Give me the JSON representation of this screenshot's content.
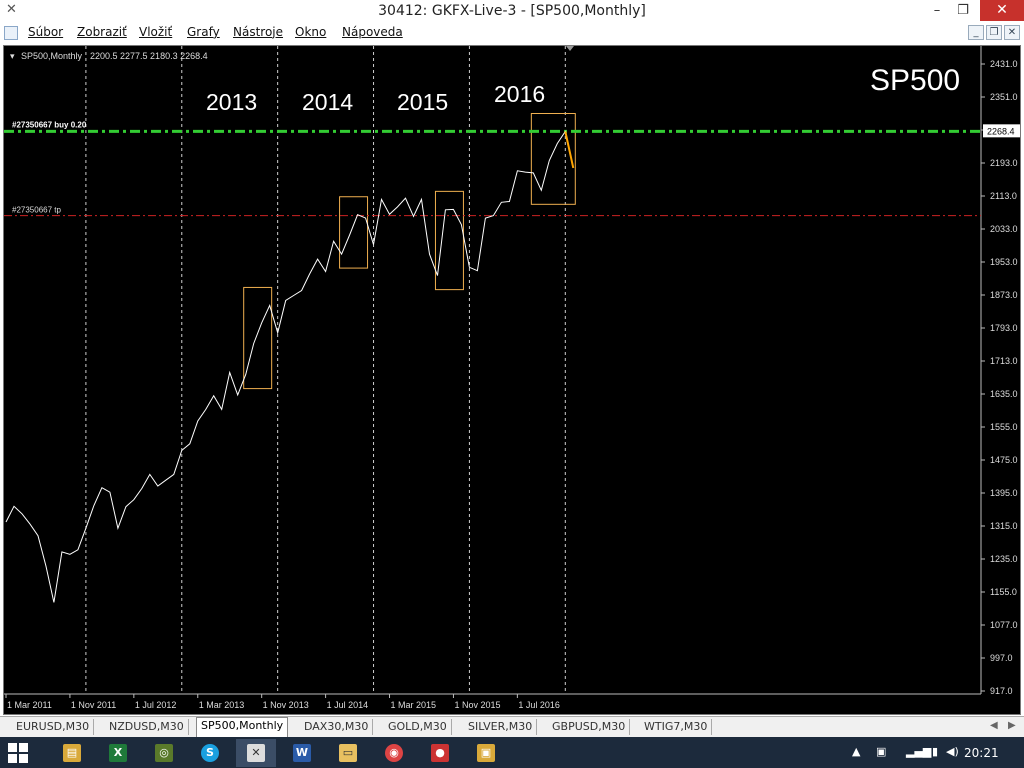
{
  "window": {
    "title": "30412: GKFX-Live-3 - [SP500,Monthly]"
  },
  "menu": [
    "Súbor",
    "Zobraziť",
    "Vložiť",
    "Grafy",
    "Nástroje",
    "Okno",
    "Nápoveda"
  ],
  "chart_header": {
    "symbol": "SP500,Monthly",
    "ohlc": "2200.5 2277.5 2180.3 2268.4"
  },
  "chart_title": "SP500",
  "chart_data": {
    "type": "line",
    "title": "SP500",
    "ylim": [
      917.0,
      2470.0
    ],
    "y_ticks": [
      "2431.0",
      "2351.0",
      "2271.0",
      "2193.0",
      "2113.0",
      "2033.0",
      "1953.0",
      "1873.0",
      "1793.0",
      "1713.0",
      "1635.0",
      "1555.0",
      "1475.0",
      "1395.0",
      "1315.0",
      "1235.0",
      "1155.0",
      "1077.0",
      "997.0",
      "917.0"
    ],
    "x_ticks": [
      "1 Mar 2011",
      "1 Nov 2011",
      "1 Jul 2012",
      "1 Mar 2013",
      "1 Nov 2013",
      "1 Jul 2014",
      "1 Mar 2015",
      "1 Nov 2015",
      "1 Jul 2016"
    ],
    "year_labels": [
      "2013",
      "2014",
      "2015",
      "2016"
    ],
    "current_price": "2268.4",
    "buy_line_label": "#27350667 buy 0.20",
    "buy_line_price": 2268.4,
    "tp_line_label": "#27350667 tp",
    "tp_line_price": 2065,
    "series": [
      {
        "values": [
          1325,
          1363,
          1345,
          1320,
          1292,
          1218,
          1131,
          1253,
          1247,
          1258,
          1310,
          1365,
          1408,
          1397,
          1310,
          1362,
          1379,
          1406,
          1440,
          1412,
          1426,
          1440,
          1498,
          1514,
          1569,
          1597,
          1630,
          1597,
          1686,
          1632,
          1681,
          1756,
          1806,
          1848,
          1782,
          1860,
          1872,
          1884,
          1924,
          1960,
          1930,
          2003,
          1972,
          2018,
          2067,
          2059,
          1995,
          2104,
          2068,
          2086,
          2107,
          2063,
          2104,
          1972,
          1920,
          2079,
          2080,
          2043,
          1940,
          1932,
          2059,
          2065,
          2097,
          2099,
          2173,
          2170,
          2168,
          2126,
          2198,
          2239,
          2268,
          2180
        ]
      }
    ]
  },
  "tabs": [
    "EURUSD,M30",
    "NZDUSD,M30",
    "SP500,Monthly",
    "DAX30,M30",
    "GOLD,M30",
    "SILVER,M30",
    "GBPUSD,M30",
    "WTIG7,M30"
  ],
  "active_tab": "SP500,Monthly",
  "taskbar": {
    "clock": "20:21"
  },
  "colors": {
    "chart_bg": "#000000",
    "price_line": "#ffffff",
    "highlight": "#ffa500",
    "buy_line": "#33cc33",
    "tp_line": "#cc2222",
    "year_box": "#f0b050"
  }
}
